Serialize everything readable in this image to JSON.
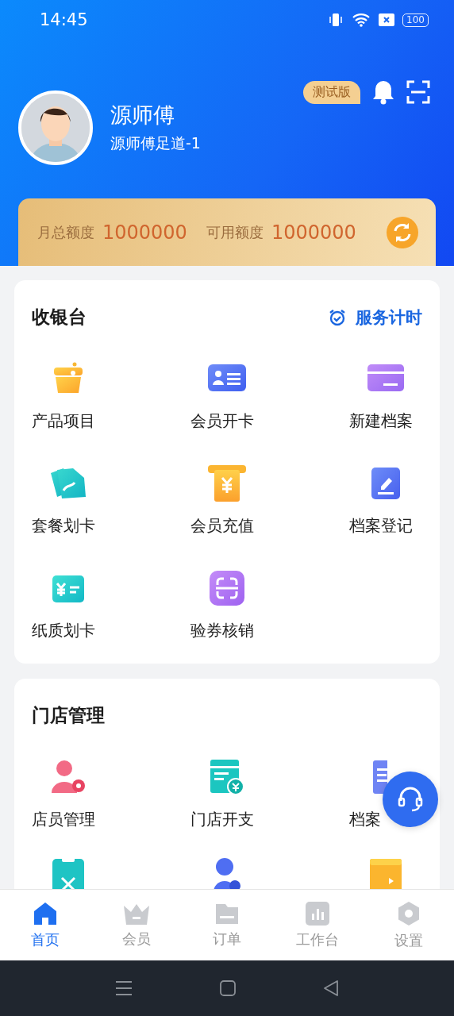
{
  "status_bar": {
    "time": "14:45",
    "battery": "100"
  },
  "header": {
    "badge": "测试版",
    "name": "源师傅",
    "store": "源师傅足道-1"
  },
  "quota": {
    "items": [
      {
        "label": "月总额度",
        "value": "1000000"
      },
      {
        "label": "可用额度",
        "value": "1000000"
      }
    ]
  },
  "cards": [
    {
      "title": "收银台",
      "action": "服务计时",
      "items": [
        {
          "kind": "tile",
          "label": "产品项目"
        },
        {
          "kind": "tile",
          "label": "会员开卡"
        },
        {
          "kind": "tile",
          "label": "新建档案"
        },
        {
          "kind": "tile",
          "label": "套餐划卡"
        },
        {
          "kind": "tile",
          "label": "会员充值"
        },
        {
          "kind": "tile",
          "label": "档案登记"
        },
        {
          "kind": "tile",
          "label": "纸质划卡"
        },
        {
          "kind": "tile",
          "label": "验券核销"
        }
      ]
    },
    {
      "title": "门店管理",
      "items": [
        {
          "kind": "tile",
          "label": "店员管理"
        },
        {
          "kind": "tile",
          "label": "门店开支"
        },
        {
          "kind": "tile",
          "label": "档案"
        },
        {
          "kind": "tile"
        },
        {
          "kind": "tile"
        },
        {
          "kind": "tile"
        }
      ]
    }
  ],
  "tab_bar": [
    {
      "label": "首页",
      "selected": true
    },
    {
      "label": "会员",
      "selected": false
    },
    {
      "label": "订单",
      "selected": false
    },
    {
      "label": "工作台",
      "selected": false
    },
    {
      "label": "设置",
      "selected": false
    }
  ]
}
